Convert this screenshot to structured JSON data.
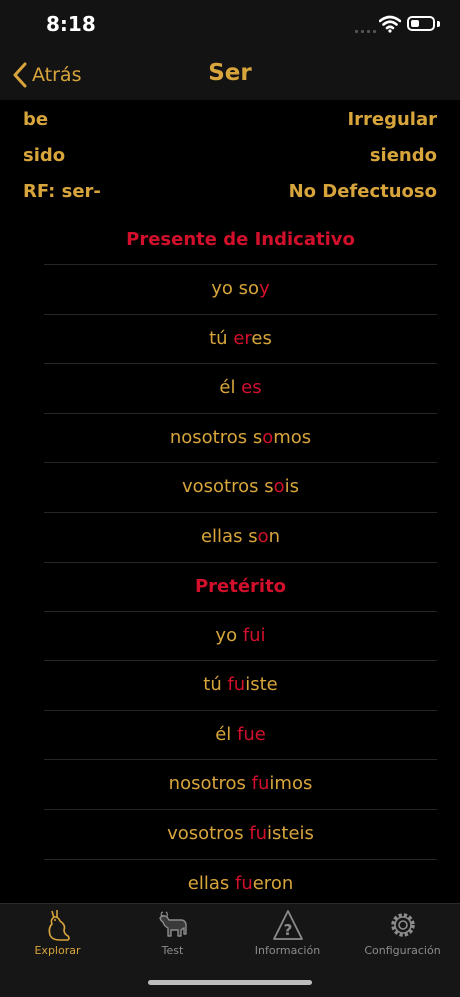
{
  "status": {
    "time": "8:18"
  },
  "nav": {
    "back_label": "Atrás",
    "title": "Ser"
  },
  "info": [
    {
      "left": "be",
      "right": "Irregular"
    },
    {
      "left": "sido",
      "right": "siendo"
    },
    {
      "left": "RF:  ser-",
      "right": "No Defectuoso"
    }
  ],
  "sections": [
    {
      "title": "Presente de Indicativo",
      "rows": [
        {
          "pre": "yo so",
          "end": "y",
          "post": ""
        },
        {
          "pre": "tú ",
          "end": "er",
          "post": "es"
        },
        {
          "pre": "él ",
          "end": "es",
          "post": ""
        },
        {
          "pre": "nosotros s",
          "end": "o",
          "post": "mos"
        },
        {
          "pre": "vosotros s",
          "end": "o",
          "post": "is"
        },
        {
          "pre": "ellas s",
          "end": "o",
          "post": "n"
        }
      ]
    },
    {
      "title": "Pretérito",
      "rows": [
        {
          "pre": "yo ",
          "end": "fui",
          "post": ""
        },
        {
          "pre": "tú ",
          "end": "fu",
          "post": "iste"
        },
        {
          "pre": "él ",
          "end": "fue",
          "post": ""
        },
        {
          "pre": "nosotros ",
          "end": "fu",
          "post": "imos"
        },
        {
          "pre": "vosotros ",
          "end": "fu",
          "post": "isteis"
        },
        {
          "pre": "ellas ",
          "end": "fu",
          "post": "eron"
        }
      ]
    }
  ],
  "tabs": [
    {
      "label": "Explorar",
      "icon": "rabbit-icon",
      "active": true
    },
    {
      "label": "Test",
      "icon": "bull-icon",
      "active": false
    },
    {
      "label": "Información",
      "icon": "warning-question-icon",
      "active": false
    },
    {
      "label": "Configuración",
      "icon": "gear-icon",
      "active": false
    }
  ],
  "colors": {
    "accent": "#d8a53c",
    "highlight": "#d2102c",
    "background": "#000000"
  }
}
